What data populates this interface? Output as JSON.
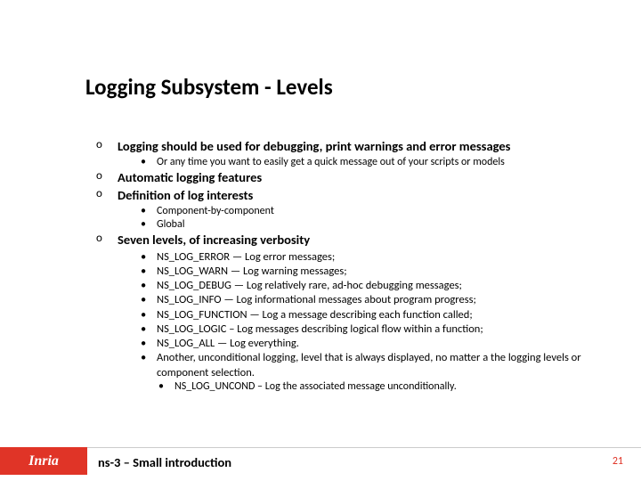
{
  "title": "Logging Subsystem - Levels",
  "items": {
    "i1": {
      "text": "Logging should be used for debugging, print warnings and error messages",
      "sub": [
        "Or any time you want to easily get a quick message out of your scripts or models"
      ]
    },
    "i2": {
      "text": "Automatic logging features"
    },
    "i3": {
      "text": "Definition of log interests",
      "sub": [
        "Component-by-component",
        "Global"
      ]
    },
    "i4": {
      "text": "Seven levels, of increasing verbosity",
      "sub": [
        "NS_LOG_ERROR — Log error messages;",
        "NS_LOG_WARN — Log warning messages;",
        "NS_LOG_DEBUG — Log relatively rare, ad-hoc debugging messages;",
        "NS_LOG_INFO — Log informational messages about program progress;",
        "NS_LOG_FUNCTION — Log a message describing each function called;",
        "NS_LOG_LOGIC – Log messages describing logical flow within a function;",
        "NS_LOG_ALL — Log everything.",
        "Another, unconditional logging, level that is always displayed, no matter a the logging levels or component selection."
      ],
      "subsub": [
        "NS_LOG_UNCOND – Log the associated message unconditionally."
      ]
    }
  },
  "footer": {
    "logo": "Inria",
    "title": "ns-3 – Small introduction",
    "page": "21"
  },
  "bullet_o": "o",
  "bullet_dot": "•"
}
